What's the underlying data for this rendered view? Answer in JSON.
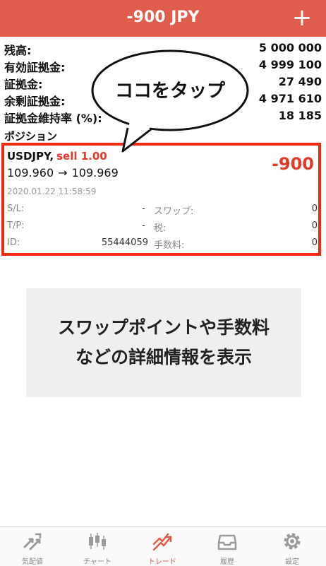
{
  "header": {
    "title": "-900 JPY",
    "add_label": "+"
  },
  "account": {
    "rows": [
      {
        "label": "残高:",
        "value": "5 000 000"
      },
      {
        "label": "有効証拠金:",
        "value": "4 999 100"
      },
      {
        "label": "証拠金:",
        "value": "27 490"
      },
      {
        "label": "余剰証拠金:",
        "value": "4 971 610"
      },
      {
        "label": "証拠金維持率 (%):",
        "value": "18 185"
      }
    ]
  },
  "positions": {
    "title": "ポジション",
    "item": {
      "symbol": "USDJPY,",
      "side": "sell 1.00",
      "open_price": "109.960",
      "arrow": "→",
      "current_price": "109.969",
      "profit": "-900",
      "datetime": "2020.01.22 11:58:59",
      "sl_label": "S/L:",
      "sl_value": "-",
      "tp_label": "T/P:",
      "tp_value": "-",
      "id_label": "ID:",
      "id_value": "55444059",
      "swap_label": "スワップ:",
      "swap_value": "0",
      "tax_label": "税:",
      "tax_value": "0",
      "fee_label": "手数料:",
      "fee_value": "0"
    }
  },
  "callout": {
    "text": "ココをタップ"
  },
  "info_panel": {
    "line1": "スワップポイントや手数料",
    "line2": "などの詳細情報を表示"
  },
  "tabbar": {
    "active_color": "#e05c4c",
    "items": [
      {
        "label": "気配値",
        "icon": "quotes-icon"
      },
      {
        "label": "チャート",
        "icon": "chart-icon"
      },
      {
        "label": "トレード",
        "icon": "trade-icon"
      },
      {
        "label": "履歴",
        "icon": "history-icon"
      },
      {
        "label": "設定",
        "icon": "settings-icon"
      }
    ]
  }
}
